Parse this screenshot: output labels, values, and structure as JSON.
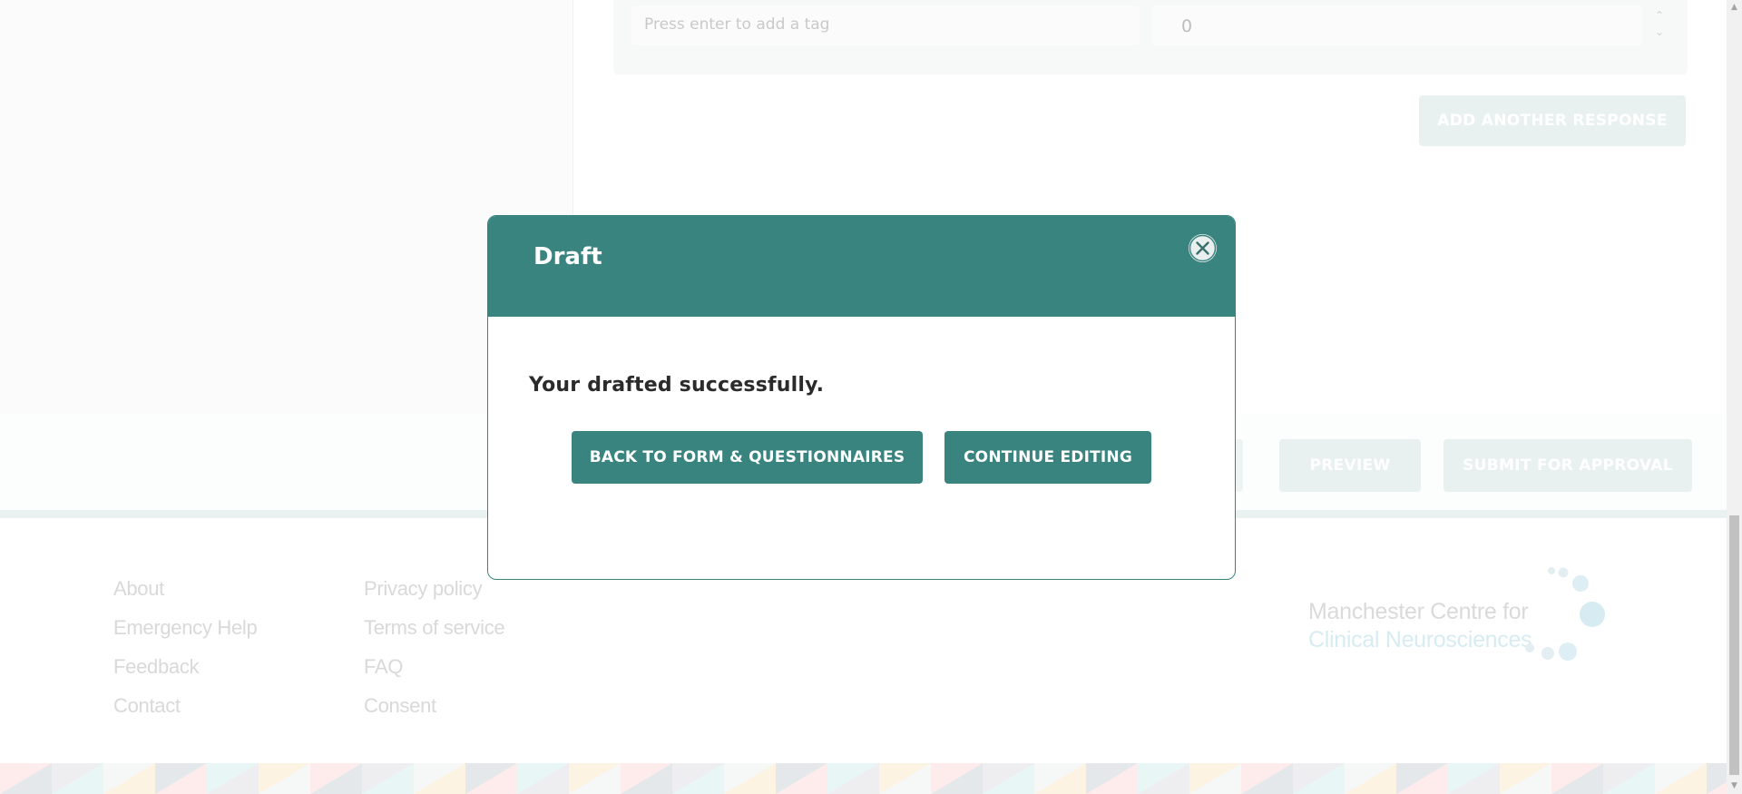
{
  "editor": {
    "tag_placeholder": "Press enter to add a tag",
    "score_value": "0",
    "add_response_label": "ADD ANOTHER RESPONSE"
  },
  "actions": {
    "preview_label": "PREVIEW",
    "submit_label": "SUBMIT FOR APPROVAL"
  },
  "footer": {
    "links_col1": [
      "About",
      "Emergency Help",
      "Feedback",
      "Contact"
    ],
    "links_col2": [
      "Privacy policy",
      "Terms of service",
      "FAQ",
      "Consent"
    ],
    "brand_line1": "Manchester Centre for",
    "brand_line2": "Clinical Neurosciences"
  },
  "modal": {
    "title": "Draft",
    "message": "Your drafted successfully.",
    "back_label": "BACK TO FORM & QUESTIONNAIRES",
    "continue_label": "CONTINUE EDITING",
    "close_icon": "close-icon"
  },
  "colors": {
    "primary": "#3a8480",
    "ghost_button": "#e9f1f0",
    "message_text": "#2b2b2b"
  }
}
